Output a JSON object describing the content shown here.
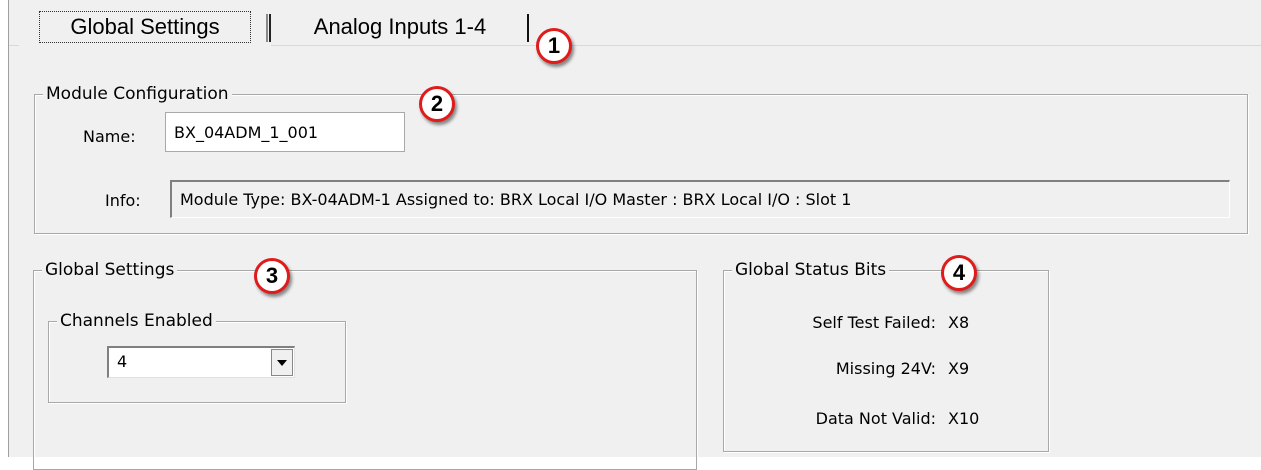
{
  "tabs": [
    {
      "label": "Global Settings",
      "active": true
    },
    {
      "label": "Analog Inputs 1-4",
      "active": false
    }
  ],
  "callouts": [
    "1",
    "2",
    "3",
    "4"
  ],
  "module_config": {
    "title": "Module Configuration",
    "name_label": "Name:",
    "name_value": "BX_04ADM_1_001",
    "info_label": "Info:",
    "info_value": "Module Type: BX-04ADM-1   Assigned to: BRX Local I/O Master : BRX Local I/O : Slot 1"
  },
  "global_settings": {
    "title": "Global Settings",
    "channels_enabled": {
      "title": "Channels Enabled",
      "selected": "4"
    }
  },
  "global_status_bits": {
    "title": "Global Status Bits",
    "rows": [
      {
        "label": "Self Test Failed:",
        "value": "X8"
      },
      {
        "label": "Missing 24V:",
        "value": "X9"
      },
      {
        "label": "Data Not Valid:",
        "value": "X10"
      }
    ]
  },
  "colors": {
    "callout_border": "#e01b1b",
    "dialog_bg": "#f0f0f0"
  }
}
